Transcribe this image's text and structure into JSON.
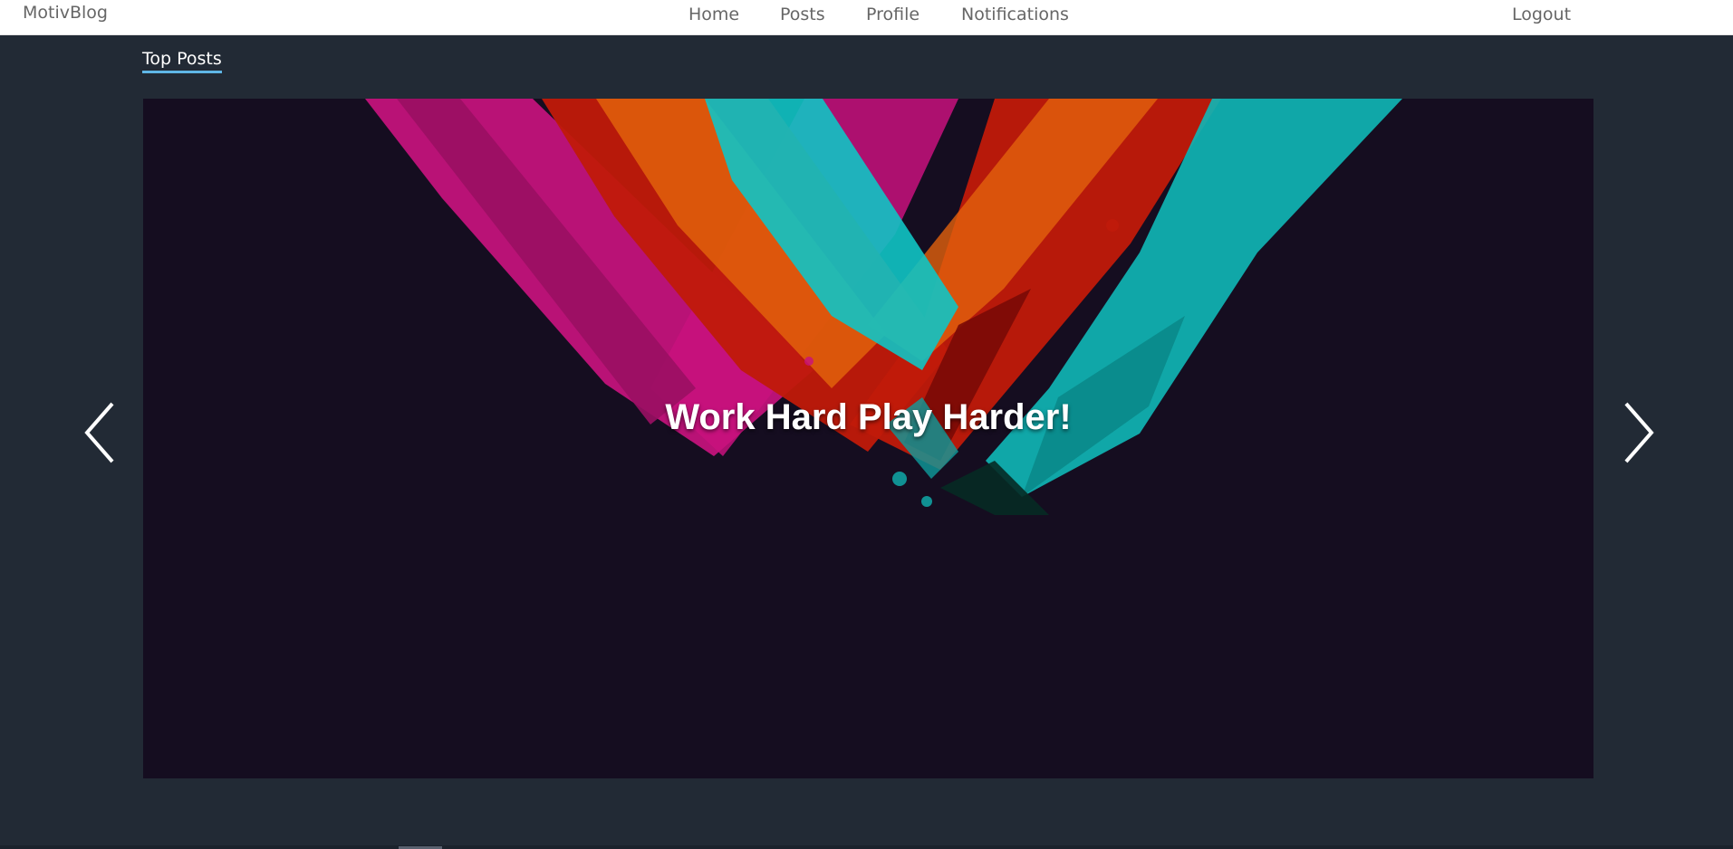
{
  "brand": "MotivBlog",
  "nav": {
    "home": "Home",
    "posts": "Posts",
    "profile": "Profile",
    "notifications": "Notifications",
    "logout": "Logout"
  },
  "section": {
    "title": "Top Posts"
  },
  "carousel": {
    "caption": "Work Hard Play Harder!",
    "prev_icon": "chevron-left-icon",
    "next_icon": "chevron-right-icon"
  },
  "colors": {
    "page_bg": "#222a35",
    "navbar_bg": "#ffffff",
    "carousel_bg": "#150d20",
    "accent_underline": "#5fb6e6",
    "art_magenta": "#c8127e",
    "art_red": "#c01a0a",
    "art_orange": "#e2620c",
    "art_cyan": "#10c4c4"
  }
}
